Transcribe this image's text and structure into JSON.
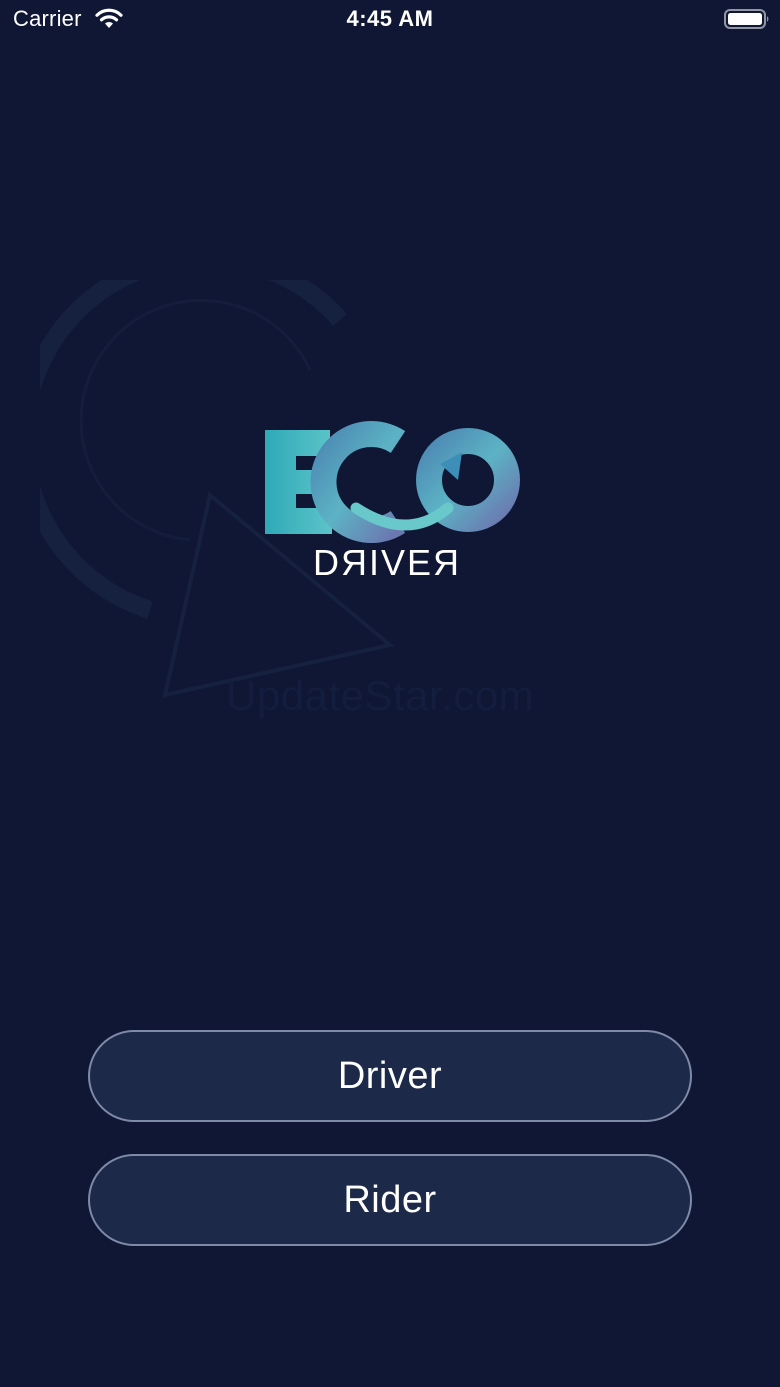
{
  "status_bar": {
    "carrier": "Carrier",
    "time": "4:45 AM"
  },
  "logo": {
    "subtitle": "DЯIVEЯ",
    "brand_colors": [
      "#3fb6c4",
      "#6ac6c8",
      "#6b7db4"
    ]
  },
  "watermark": {
    "text": "UpdateStar.com"
  },
  "buttons": {
    "driver_label": "Driver",
    "rider_label": "Rider"
  },
  "colors": {
    "background": "#0f1734",
    "button_fill": "#1c2948",
    "button_border": "#7f8aa8"
  }
}
